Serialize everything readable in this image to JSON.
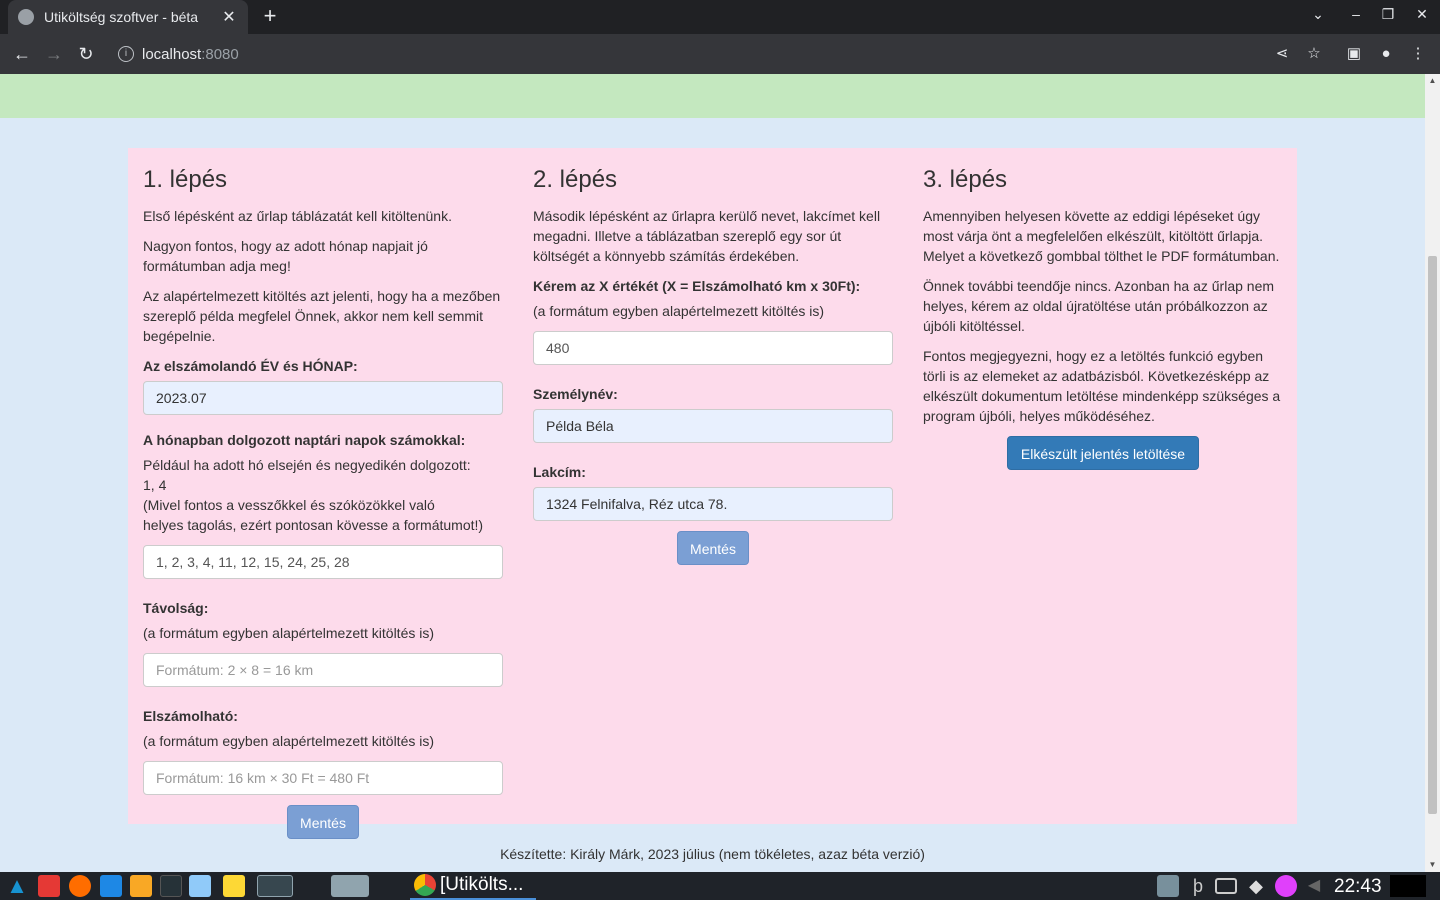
{
  "browser": {
    "tab_title": "Utiköltség szoftver - béta",
    "url_host": "localhost",
    "url_port": ":8080"
  },
  "step1": {
    "heading": "1. lépés",
    "p1": "Első lépésként az űrlap táblázatát kell kitöltenünk.",
    "p2": "Nagyon fontos, hogy az adott hónap napjait jó formátumban adja meg!",
    "p3": "Az alapértelmezett kitöltés azt jelenti, hogy ha a mezőben szereplő példa megfelel Önnek, akkor nem kell semmit begépelnie.",
    "month_label": "Az elszámolandó ÉV és HÓNAP:",
    "month_value": "2023.07",
    "days_label": "A hónapban dolgozott naptári napok számokkal:",
    "days_hint_1": "Például ha adott hó elsején és negyedikén dolgozott:",
    "days_hint_2": "1, 4",
    "days_hint_3": "(Mivel fontos a vesszőkkel és szóközökkel való",
    "days_hint_4": "helyes tagolás, ezért pontosan kövesse a formátumot!)",
    "days_value": "1, 2, 3, 4, 11, 12, 15, 24, 25, 28",
    "distance_label": "Távolság:",
    "distance_hint": "(a formátum egyben alapértelmezett kitöltés is)",
    "distance_placeholder": "Formátum: 2 × 8 = 16 km",
    "billable_label": "Elszámolható:",
    "billable_hint": "(a formátum egyben alapértelmezett kitöltés is)",
    "billable_placeholder": "Formátum: 16 km × 30 Ft = 480 Ft",
    "save_label": "Mentés"
  },
  "step2": {
    "heading": "2. lépés",
    "p1": "Második lépésként az űrlapra kerülő nevet, lakcímet kell megadni. Illetve a táblázatban szereplő egy sor út költségét a könnyebb számítás érdekében.",
    "x_label": "Kérem az X értékét (X = Elszámolható km x 30Ft):",
    "x_hint": "(a formátum egyben alapértelmezett kitöltés is)",
    "x_value": "480",
    "name_label": "Személynév:",
    "name_value": "Példa Béla",
    "address_label": "Lakcím:",
    "address_value": "1324 Felnifalva, Réz utca 78.",
    "save_label": "Mentés"
  },
  "step3": {
    "heading": "3. lépés",
    "p1": "Amennyiben helyesen követte az eddigi lépéseket úgy most várja önt a megfelelően elkészült, kitöltött űrlapja. Melyet a következő gombbal tölthet le PDF formátumban.",
    "p2": "Önnek további teendője nincs. Azonban ha az űrlap nem helyes, kérem az oldal újratöltése után próbálkozzon az újbóli kitöltéssel.",
    "p3": "Fontos megjegyezni, hogy ez a letöltés funkció egyben törli is az elemeket az adatbázisból. Következésképp az elkészült dokumentum letöltése mindenképp szükséges a program újbóli, helyes működéséhez.",
    "download_label": "Elkészült jelentés letöltése"
  },
  "footer": "Készítette: Király Márk, 2023 július (nem tökéletes, azaz béta verzió)",
  "taskbar": {
    "active_task": "[Utikölts...",
    "clock": "22:43"
  }
}
